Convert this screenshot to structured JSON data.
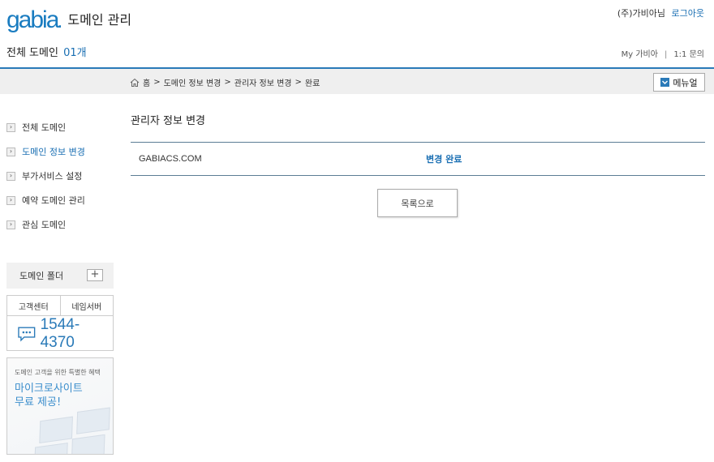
{
  "header": {
    "logo_text": "gabia",
    "title": "도메인 관리",
    "user_name": "(주)가비아님",
    "logout_label": "로그아웃",
    "domain_count_label": "전체 도메인",
    "domain_count_value": "01개",
    "links": [
      "My 가비아",
      "1:1 문의"
    ]
  },
  "breadcrumb": {
    "items": [
      "홈",
      "도메인 정보 변경",
      "관리자 정보 변경",
      "완료"
    ],
    "menu_button": "메뉴얼"
  },
  "sidebar": {
    "items": [
      {
        "label": "전체 도메인"
      },
      {
        "label": "도메인 정보 변경"
      },
      {
        "label": "부가서비스 설정"
      },
      {
        "label": "예약 도메인 관리"
      },
      {
        "label": "관심 도메인"
      }
    ],
    "folder_label": "도메인 폴더",
    "cs_tabs": [
      "고객센터",
      "네임서버"
    ],
    "phone": "1544-4370",
    "promo_small": "도메인 고객을 위한 특별한 혜택",
    "promo_line1": "마이크로사이트",
    "promo_line2": "무료 제공!"
  },
  "main": {
    "title": "관리자 정보 변경",
    "domain": "GABIACS.COM",
    "status": "변경 완료",
    "list_button": "목록으로"
  },
  "colors": {
    "brand": "#1a7cc0",
    "accent_line": "#2a7ab8",
    "link": "#1a6fb3"
  }
}
